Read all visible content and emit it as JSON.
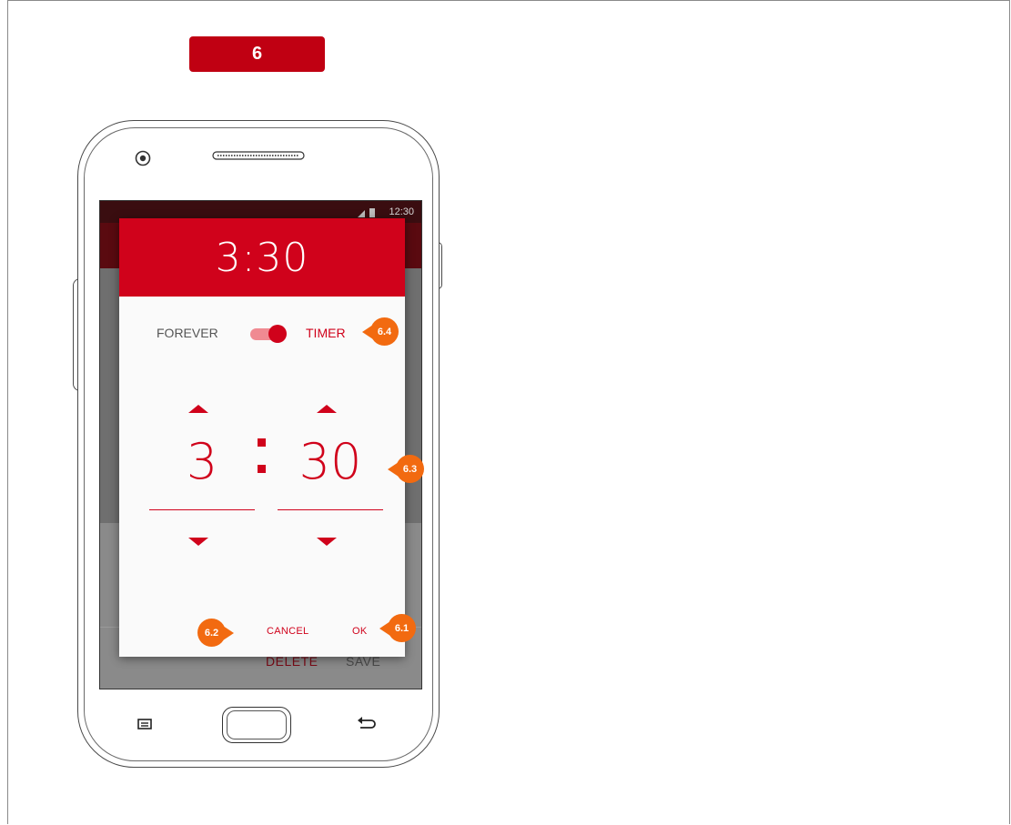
{
  "step": {
    "label": "6"
  },
  "statusbar": {
    "time": "12:30"
  },
  "background": {
    "delete_label": "DELETE",
    "save_label": "SAVE"
  },
  "dialog": {
    "header_time": "3:30",
    "mode_left": "FOREVER",
    "mode_right": "TIMER",
    "toggle_on": true,
    "hours": "3",
    "minutes": "30",
    "cancel_label": "CANCEL",
    "ok_label": "OK"
  },
  "annotations": {
    "a61": "6.1",
    "a62": "6.2",
    "a63": "6.3",
    "a64": "6.4"
  },
  "colors": {
    "accent": "#d0021b",
    "step_badge": "#c00012",
    "annotation": "#f26a10"
  },
  "icons": [
    "camera-icon",
    "speaker-grille-icon",
    "signal-icon",
    "battery-icon",
    "menu-icon",
    "home-button",
    "back-icon",
    "arrow-up-icon",
    "arrow-down-icon"
  ]
}
